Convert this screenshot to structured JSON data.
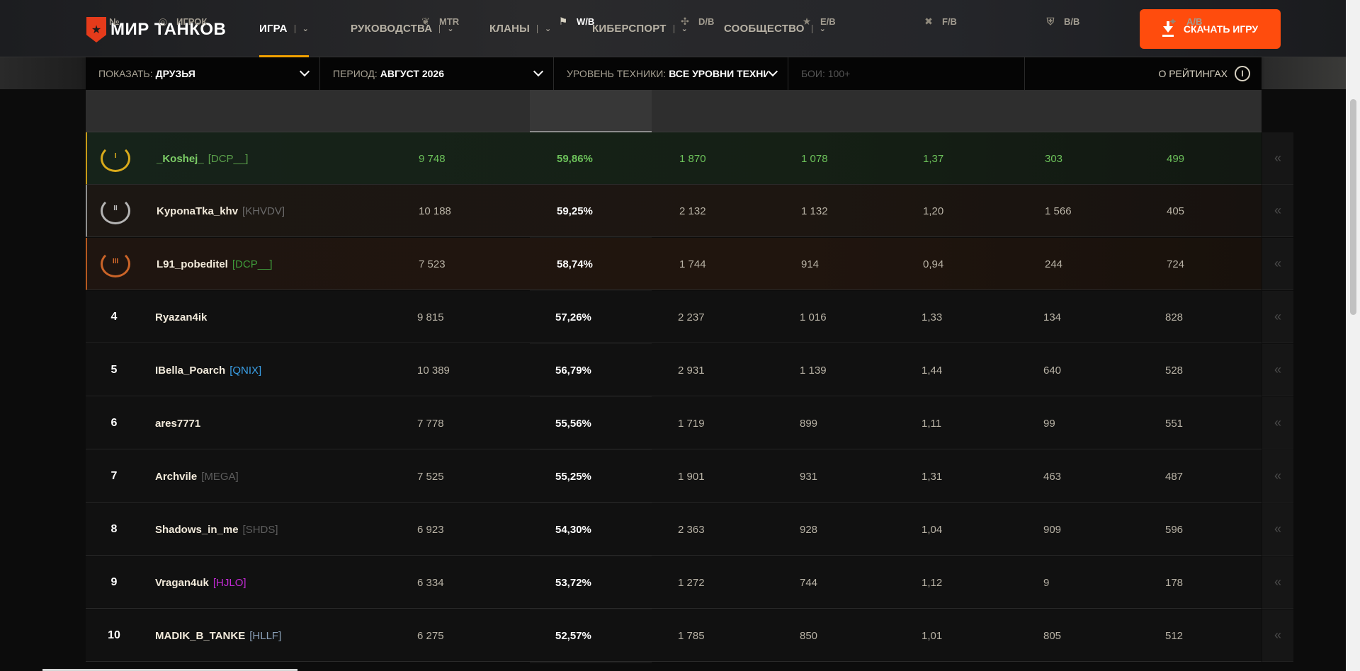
{
  "brand": {
    "name": "МИР ТАНКОВ"
  },
  "nav": [
    {
      "label": "ИГРА",
      "active": true
    },
    {
      "label": "РУКОВОДСТВА",
      "active": false
    },
    {
      "label": "КЛАНЫ",
      "active": false
    },
    {
      "label": "КИБЕРСПОРТ",
      "active": false
    },
    {
      "label": "СООБЩЕСТВО",
      "active": false
    }
  ],
  "download": {
    "label": "СКАЧАТЬ ИГРУ"
  },
  "filters": {
    "show_label": "ПОКАЗАТЬ:",
    "show_value": "ДРУЗЬЯ",
    "period_label": "ПЕРИОД:",
    "period_value": "АВГУСТ 2026",
    "tech_label": "УРОВЕНЬ ТЕХНИКИ:",
    "tech_value": "ВСЕ УРОВНИ ТЕХНИКИ",
    "battles_label": "БОИ: 100+",
    "about_label": "О РЕЙТИНГАХ"
  },
  "columns": {
    "rank": "№",
    "player": "ИГРОК",
    "mtr": "MTR",
    "wb": "W/B",
    "db": "D/B",
    "eb": "E/B",
    "fb": "F/B",
    "bb": "B/B",
    "ab": "A/B"
  },
  "rows": [
    {
      "rank": "I",
      "player": "_Koshej_",
      "clan": "[DCP__]",
      "clan_color": "#5aa04a",
      "mtr": "9 748",
      "wb": "59,86%",
      "db": "1 870",
      "eb": "1 078",
      "fb": "1,37",
      "bb": "303",
      "ab": "499"
    },
    {
      "rank": "II",
      "player": "KyponaTka_khv",
      "clan": "[KHVDV]",
      "clan_color": "#6b6b6b",
      "mtr": "10 188",
      "wb": "59,25%",
      "db": "2 132",
      "eb": "1 132",
      "fb": "1,20",
      "bb": "1 566",
      "ab": "405"
    },
    {
      "rank": "III",
      "player": "L91_pobeditel",
      "clan": "[DCP__]",
      "clan_color": "#3f9a3a",
      "mtr": "7 523",
      "wb": "58,74%",
      "db": "1 744",
      "eb": "914",
      "fb": "0,94",
      "bb": "244",
      "ab": "724"
    },
    {
      "rank": "4",
      "player": "Ryazan4ik",
      "clan": "",
      "clan_color": "#6b6b6b",
      "mtr": "9 815",
      "wb": "57,26%",
      "db": "2 237",
      "eb": "1 016",
      "fb": "1,33",
      "bb": "134",
      "ab": "828"
    },
    {
      "rank": "5",
      "player": "IBella_Poarch",
      "clan": "[QNIX]",
      "clan_color": "#3aa0e8",
      "mtr": "10 389",
      "wb": "56,79%",
      "db": "2 931",
      "eb": "1 139",
      "fb": "1,44",
      "bb": "640",
      "ab": "528"
    },
    {
      "rank": "6",
      "player": "ares7771",
      "clan": "",
      "clan_color": "#6b6b6b",
      "mtr": "7 778",
      "wb": "55,56%",
      "db": "1 719",
      "eb": "899",
      "fb": "1,11",
      "bb": "99",
      "ab": "551"
    },
    {
      "rank": "7",
      "player": "Archvile",
      "clan": "[MEGA]",
      "clan_color": "#5e5e5e",
      "mtr": "7 525",
      "wb": "55,25%",
      "db": "1 901",
      "eb": "931",
      "fb": "1,31",
      "bb": "463",
      "ab": "487"
    },
    {
      "rank": "8",
      "player": "Shadows_in_me",
      "clan": "[SHDS]",
      "clan_color": "#5e5e5e",
      "mtr": "6 923",
      "wb": "54,30%",
      "db": "2 363",
      "eb": "928",
      "fb": "1,04",
      "bb": "909",
      "ab": "596"
    },
    {
      "rank": "9",
      "player": "Vragan4uk",
      "clan": "[HJLO]",
      "clan_color": "#c42ad6",
      "mtr": "6 334",
      "wb": "53,72%",
      "db": "1 272",
      "eb": "744",
      "fb": "1,12",
      "bb": "9",
      "ab": "178"
    },
    {
      "rank": "10",
      "player": "MADIK_B_TANKE",
      "clan": "[HLLF]",
      "clan_color": "#8aa0b8",
      "mtr": "6 275",
      "wb": "52,57%",
      "db": "1 785",
      "eb": "850",
      "fb": "1,01",
      "bb": "805",
      "ab": "512"
    }
  ],
  "colors": {
    "accent": "#ff4c0d",
    "active_tab": "#f2a100",
    "gold": "#c89b17",
    "silver": "#8f8f8f",
    "bronze": "#b5591f"
  }
}
